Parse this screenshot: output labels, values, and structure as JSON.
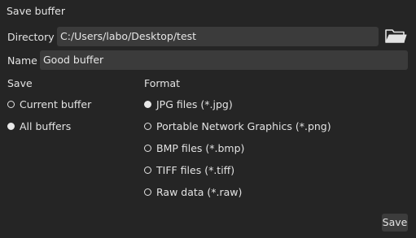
{
  "dialog": {
    "title": "Save buffer"
  },
  "directory": {
    "label": "Directory",
    "value": "C:/Users/labo/Desktop/test",
    "browse_icon": "folder-icon"
  },
  "name": {
    "label": "Name",
    "value": "Good buffer"
  },
  "save_scope": {
    "heading": "Save",
    "options": [
      {
        "label": "Current buffer",
        "selected": false
      },
      {
        "label": "All buffers",
        "selected": true
      }
    ]
  },
  "format": {
    "heading": "Format",
    "options": [
      {
        "label": "JPG files (*.jpg)",
        "selected": true
      },
      {
        "label": "Portable Network Graphics (*.png)",
        "selected": false
      },
      {
        "label": "BMP files (*.bmp)",
        "selected": false
      },
      {
        "label": "TIFF files (*.tiff)",
        "selected": false
      },
      {
        "label": "Raw data (*.raw)",
        "selected": false
      }
    ]
  },
  "footer": {
    "save_label": "Save"
  },
  "colors": {
    "background": "#252525",
    "field": "#3b3b3b",
    "text": "#e3e3e3"
  }
}
